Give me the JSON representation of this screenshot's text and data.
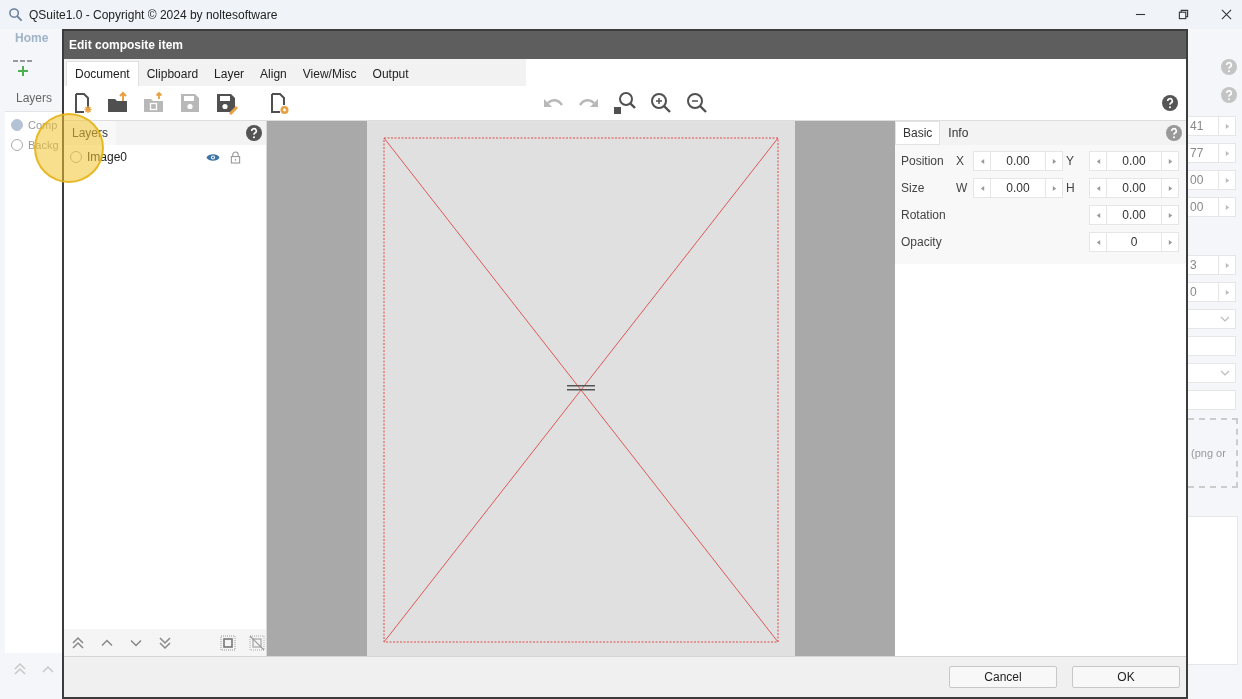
{
  "app": {
    "title": "QSuite1.0 - Copyright © 2024 by noltesoftware",
    "ribbon_tab": "Home",
    "panel_title": "Layers",
    "layers": [
      {
        "label": "Comp",
        "selected": true
      },
      {
        "label": "Backg",
        "selected": false
      }
    ],
    "side_sections": [
      {
        "fields": [
          {
            "kind": "spin",
            "value": "41"
          },
          {
            "kind": "spin",
            "value": "77"
          },
          {
            "kind": "spin",
            "value": "00"
          },
          {
            "kind": "spin",
            "value": "00"
          }
        ]
      },
      {
        "fields": [
          {
            "kind": "spin",
            "value": "3"
          },
          {
            "kind": "spin",
            "value": "0"
          },
          {
            "kind": "dropdown"
          },
          {
            "kind": "text"
          },
          {
            "kind": "dropdown"
          },
          {
            "kind": "text"
          },
          {
            "kind": "dropzone",
            "value": "(png or"
          },
          {
            "kind": "textarea"
          }
        ]
      }
    ]
  },
  "dialog": {
    "title": "Edit composite item",
    "tabs": [
      {
        "label": "Document",
        "selected": true
      },
      {
        "label": "Clipboard",
        "selected": false
      },
      {
        "label": "Layer",
        "selected": false
      },
      {
        "label": "Align",
        "selected": false
      },
      {
        "label": "View/Misc",
        "selected": false
      },
      {
        "label": "Output",
        "selected": false
      }
    ],
    "toolbar": [
      {
        "tools": [
          {
            "kind": "new",
            "disabled": false
          },
          {
            "kind": "open",
            "disabled": false
          },
          {
            "kind": "import",
            "disabled": true
          },
          {
            "kind": "save",
            "disabled": true
          },
          {
            "kind": "save-as",
            "disabled": false
          }
        ]
      },
      {
        "tools": [
          {
            "kind": "doc-settings",
            "disabled": false
          }
        ]
      },
      {
        "tools": [
          {
            "kind": "undo",
            "disabled": true
          },
          {
            "kind": "redo",
            "disabled": true
          },
          {
            "kind": "zoom-fit",
            "disabled": false
          },
          {
            "kind": "zoom-in",
            "disabled": false
          },
          {
            "kind": "zoom-out",
            "disabled": false
          }
        ]
      }
    ],
    "layers_panel": {
      "tab": "Layers",
      "items": [
        {
          "name": "Image0",
          "selected": false
        }
      ],
      "tools": [
        {
          "kind": "top"
        },
        {
          "kind": "up"
        },
        {
          "kind": "down"
        },
        {
          "kind": "bottom"
        },
        {
          "kind": "select-all"
        },
        {
          "kind": "deselect"
        }
      ]
    },
    "properties": {
      "tabs": [
        {
          "label": "Basic",
          "selected": true
        },
        {
          "label": "Info",
          "selected": false
        }
      ],
      "rows": [
        {
          "label": "Position",
          "fields": [
            {
              "axis": "X",
              "value": "0.00"
            },
            {
              "axis": "Y",
              "value": "0.00"
            }
          ]
        },
        {
          "label": "Size",
          "fields": [
            {
              "axis": "W",
              "value": "0.00"
            },
            {
              "axis": "H",
              "value": "0.00"
            }
          ]
        },
        {
          "label": "Rotation",
          "fields": [
            {
              "value": "0.00"
            }
          ]
        },
        {
          "label": "Opacity",
          "fields": [
            {
              "value": "0"
            }
          ]
        }
      ]
    },
    "buttons": [
      "Cancel",
      "OK"
    ]
  }
}
